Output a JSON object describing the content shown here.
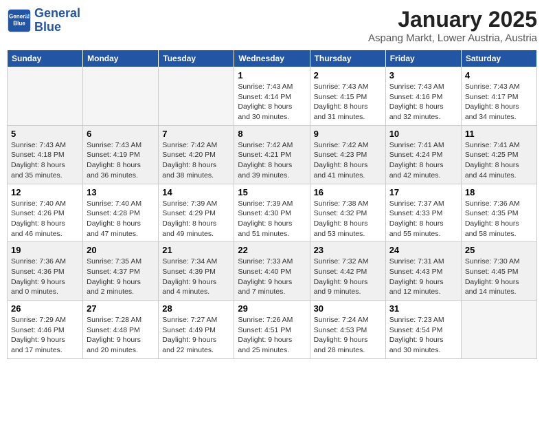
{
  "header": {
    "logo_line1": "General",
    "logo_line2": "Blue",
    "month": "January 2025",
    "location": "Aspang Markt, Lower Austria, Austria"
  },
  "weekdays": [
    "Sunday",
    "Monday",
    "Tuesday",
    "Wednesday",
    "Thursday",
    "Friday",
    "Saturday"
  ],
  "weeks": [
    {
      "shaded": false,
      "days": [
        {
          "num": "",
          "info": ""
        },
        {
          "num": "",
          "info": ""
        },
        {
          "num": "",
          "info": ""
        },
        {
          "num": "1",
          "info": "Sunrise: 7:43 AM\nSunset: 4:14 PM\nDaylight: 8 hours\nand 30 minutes."
        },
        {
          "num": "2",
          "info": "Sunrise: 7:43 AM\nSunset: 4:15 PM\nDaylight: 8 hours\nand 31 minutes."
        },
        {
          "num": "3",
          "info": "Sunrise: 7:43 AM\nSunset: 4:16 PM\nDaylight: 8 hours\nand 32 minutes."
        },
        {
          "num": "4",
          "info": "Sunrise: 7:43 AM\nSunset: 4:17 PM\nDaylight: 8 hours\nand 34 minutes."
        }
      ]
    },
    {
      "shaded": true,
      "days": [
        {
          "num": "5",
          "info": "Sunrise: 7:43 AM\nSunset: 4:18 PM\nDaylight: 8 hours\nand 35 minutes."
        },
        {
          "num": "6",
          "info": "Sunrise: 7:43 AM\nSunset: 4:19 PM\nDaylight: 8 hours\nand 36 minutes."
        },
        {
          "num": "7",
          "info": "Sunrise: 7:42 AM\nSunset: 4:20 PM\nDaylight: 8 hours\nand 38 minutes."
        },
        {
          "num": "8",
          "info": "Sunrise: 7:42 AM\nSunset: 4:21 PM\nDaylight: 8 hours\nand 39 minutes."
        },
        {
          "num": "9",
          "info": "Sunrise: 7:42 AM\nSunset: 4:23 PM\nDaylight: 8 hours\nand 41 minutes."
        },
        {
          "num": "10",
          "info": "Sunrise: 7:41 AM\nSunset: 4:24 PM\nDaylight: 8 hours\nand 42 minutes."
        },
        {
          "num": "11",
          "info": "Sunrise: 7:41 AM\nSunset: 4:25 PM\nDaylight: 8 hours\nand 44 minutes."
        }
      ]
    },
    {
      "shaded": false,
      "days": [
        {
          "num": "12",
          "info": "Sunrise: 7:40 AM\nSunset: 4:26 PM\nDaylight: 8 hours\nand 46 minutes."
        },
        {
          "num": "13",
          "info": "Sunrise: 7:40 AM\nSunset: 4:28 PM\nDaylight: 8 hours\nand 47 minutes."
        },
        {
          "num": "14",
          "info": "Sunrise: 7:39 AM\nSunset: 4:29 PM\nDaylight: 8 hours\nand 49 minutes."
        },
        {
          "num": "15",
          "info": "Sunrise: 7:39 AM\nSunset: 4:30 PM\nDaylight: 8 hours\nand 51 minutes."
        },
        {
          "num": "16",
          "info": "Sunrise: 7:38 AM\nSunset: 4:32 PM\nDaylight: 8 hours\nand 53 minutes."
        },
        {
          "num": "17",
          "info": "Sunrise: 7:37 AM\nSunset: 4:33 PM\nDaylight: 8 hours\nand 55 minutes."
        },
        {
          "num": "18",
          "info": "Sunrise: 7:36 AM\nSunset: 4:35 PM\nDaylight: 8 hours\nand 58 minutes."
        }
      ]
    },
    {
      "shaded": true,
      "days": [
        {
          "num": "19",
          "info": "Sunrise: 7:36 AM\nSunset: 4:36 PM\nDaylight: 9 hours\nand 0 minutes."
        },
        {
          "num": "20",
          "info": "Sunrise: 7:35 AM\nSunset: 4:37 PM\nDaylight: 9 hours\nand 2 minutes."
        },
        {
          "num": "21",
          "info": "Sunrise: 7:34 AM\nSunset: 4:39 PM\nDaylight: 9 hours\nand 4 minutes."
        },
        {
          "num": "22",
          "info": "Sunrise: 7:33 AM\nSunset: 4:40 PM\nDaylight: 9 hours\nand 7 minutes."
        },
        {
          "num": "23",
          "info": "Sunrise: 7:32 AM\nSunset: 4:42 PM\nDaylight: 9 hours\nand 9 minutes."
        },
        {
          "num": "24",
          "info": "Sunrise: 7:31 AM\nSunset: 4:43 PM\nDaylight: 9 hours\nand 12 minutes."
        },
        {
          "num": "25",
          "info": "Sunrise: 7:30 AM\nSunset: 4:45 PM\nDaylight: 9 hours\nand 14 minutes."
        }
      ]
    },
    {
      "shaded": false,
      "days": [
        {
          "num": "26",
          "info": "Sunrise: 7:29 AM\nSunset: 4:46 PM\nDaylight: 9 hours\nand 17 minutes."
        },
        {
          "num": "27",
          "info": "Sunrise: 7:28 AM\nSunset: 4:48 PM\nDaylight: 9 hours\nand 20 minutes."
        },
        {
          "num": "28",
          "info": "Sunrise: 7:27 AM\nSunset: 4:49 PM\nDaylight: 9 hours\nand 22 minutes."
        },
        {
          "num": "29",
          "info": "Sunrise: 7:26 AM\nSunset: 4:51 PM\nDaylight: 9 hours\nand 25 minutes."
        },
        {
          "num": "30",
          "info": "Sunrise: 7:24 AM\nSunset: 4:53 PM\nDaylight: 9 hours\nand 28 minutes."
        },
        {
          "num": "31",
          "info": "Sunrise: 7:23 AM\nSunset: 4:54 PM\nDaylight: 9 hours\nand 30 minutes."
        },
        {
          "num": "",
          "info": ""
        }
      ]
    }
  ]
}
